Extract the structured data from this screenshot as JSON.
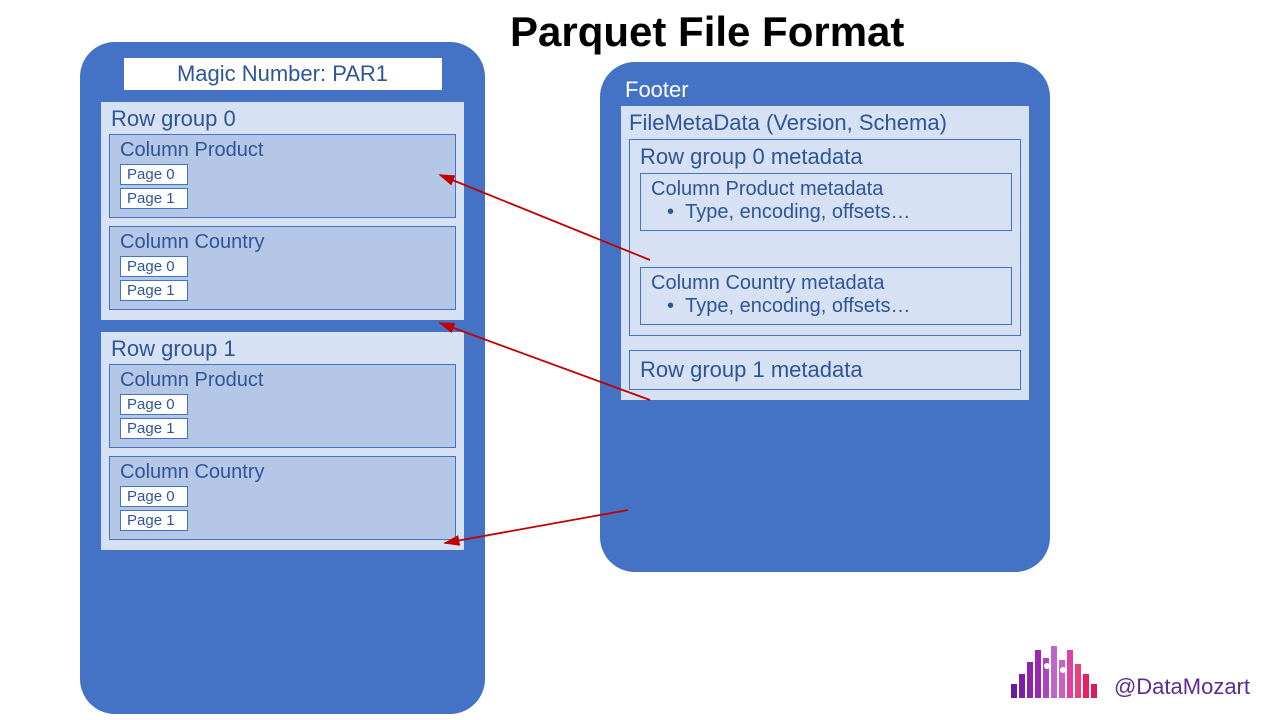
{
  "title": "Parquet File Format",
  "magic_number": "Magic Number: PAR1",
  "row_groups": [
    {
      "label": "Row group 0",
      "columns": [
        {
          "label": "Column Product",
          "pages": [
            "Page 0",
            "Page 1"
          ]
        },
        {
          "label": "Column Country",
          "pages": [
            "Page 0",
            "Page 1"
          ]
        }
      ]
    },
    {
      "label": "Row group 1",
      "columns": [
        {
          "label": "Column Product",
          "pages": [
            "Page 0",
            "Page 1"
          ]
        },
        {
          "label": "Column Country",
          "pages": [
            "Page 0",
            "Page 1"
          ]
        }
      ]
    }
  ],
  "footer": {
    "label": "Footer",
    "filemeta_label": "FileMetaData (Version, Schema)",
    "rg0_meta": {
      "label": "Row group 0 metadata",
      "columns": [
        {
          "title": "Column Product metadata",
          "detail": "Type, encoding, offsets…"
        },
        {
          "title": "Column Country metadata",
          "detail": "Type, encoding, offsets…"
        }
      ]
    },
    "rg1_meta_label": "Row group 1 metadata"
  },
  "bullet_char": "•",
  "credit_handle": "@DataMozart",
  "colors": {
    "container": "#4472c4",
    "light": "#d6e1f3",
    "mid": "#b4c7e7",
    "text": "#2f5597",
    "arrow": "#c00000"
  }
}
